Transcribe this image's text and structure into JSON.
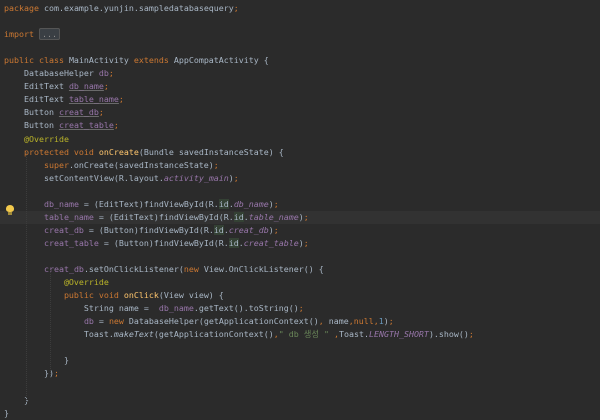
{
  "editor": {
    "lines": [
      {
        "t": [
          {
            "s": "package ",
            "c": "kw"
          },
          {
            "s": "com.example.yunjin.sampledatabasequery"
          },
          {
            "s": ";",
            "c": "kw"
          }
        ]
      },
      {
        "t": []
      },
      {
        "t": [
          {
            "s": "import ",
            "c": "kw"
          },
          {
            "s": "...",
            "c": "fold"
          }
        ]
      },
      {
        "t": []
      },
      {
        "t": [
          {
            "s": "public class ",
            "c": "kw"
          },
          {
            "s": "MainActivity "
          },
          {
            "s": "extends ",
            "c": "kw"
          },
          {
            "s": "AppCompatActivity {"
          }
        ]
      },
      {
        "t": [
          {
            "s": "    DatabaseHelper "
          },
          {
            "s": "db",
            "c": "fld"
          },
          {
            "s": ";",
            "c": "kw"
          }
        ]
      },
      {
        "t": [
          {
            "s": "    EditText "
          },
          {
            "s": "db_name",
            "c": "fld ul"
          },
          {
            "s": ";",
            "c": "kw"
          }
        ]
      },
      {
        "t": [
          {
            "s": "    EditText "
          },
          {
            "s": "table_name",
            "c": "fld ul"
          },
          {
            "s": ";",
            "c": "kw"
          }
        ]
      },
      {
        "t": [
          {
            "s": "    Button "
          },
          {
            "s": "creat_db",
            "c": "fld ul"
          },
          {
            "s": ";",
            "c": "kw"
          }
        ]
      },
      {
        "t": [
          {
            "s": "    Button "
          },
          {
            "s": "creat_table",
            "c": "fld ul"
          },
          {
            "s": ";",
            "c": "kw"
          }
        ]
      },
      {
        "t": [
          {
            "s": "    @Override",
            "c": "ann"
          }
        ]
      },
      {
        "t": [
          {
            "s": "    protected void ",
            "c": "kw"
          },
          {
            "s": "onCreate",
            "c": "fn"
          },
          {
            "s": "(Bundle savedInstanceState) {"
          }
        ]
      },
      {
        "t": [
          {
            "s": "        super",
            "c": "kw"
          },
          {
            "s": ".onCreate(savedInstanceState)"
          },
          {
            "s": ";",
            "c": "kw"
          }
        ]
      },
      {
        "t": [
          {
            "s": "        setContentView(R.layout."
          },
          {
            "s": "activity_main",
            "c": "ital"
          },
          {
            "s": ")"
          },
          {
            "s": ";",
            "c": "kw"
          }
        ]
      },
      {
        "t": []
      },
      {
        "t": [
          {
            "s": "        "
          },
          {
            "s": "db_name",
            "c": "fld"
          },
          {
            "s": " = (EditText)findViewById(R."
          },
          {
            "s": "id",
            "c": "idhl"
          },
          {
            "s": "."
          },
          {
            "s": "db_name",
            "c": "ital"
          },
          {
            "s": ")"
          },
          {
            "s": ";",
            "c": "kw"
          }
        ]
      },
      {
        "t": [
          {
            "s": "        "
          },
          {
            "s": "table_name",
            "c": "fld"
          },
          {
            "s": " = (EditText)findViewById(R."
          },
          {
            "s": "id",
            "c": "idhl"
          },
          {
            "s": "."
          },
          {
            "s": "table_name",
            "c": "ital"
          },
          {
            "s": ")"
          },
          {
            "s": ";",
            "c": "kw"
          }
        ]
      },
      {
        "t": [
          {
            "s": "        "
          },
          {
            "s": "creat_db",
            "c": "fld"
          },
          {
            "s": " = (Button)findViewById(R."
          },
          {
            "s": "id",
            "c": "idhl"
          },
          {
            "s": "."
          },
          {
            "s": "creat_db",
            "c": "ital"
          },
          {
            "s": ")"
          },
          {
            "s": ";",
            "c": "kw"
          }
        ]
      },
      {
        "t": [
          {
            "s": "        "
          },
          {
            "s": "creat_table",
            "c": "fld"
          },
          {
            "s": " = (Button)findViewById(R."
          },
          {
            "s": "id",
            "c": "idhl"
          },
          {
            "s": "."
          },
          {
            "s": "creat_table",
            "c": "ital"
          },
          {
            "s": ")"
          },
          {
            "s": ";",
            "c": "kw"
          }
        ]
      },
      {
        "t": []
      },
      {
        "t": [
          {
            "s": "        "
          },
          {
            "s": "creat_db",
            "c": "fld"
          },
          {
            "s": ".setOnClickListener("
          },
          {
            "s": "new ",
            "c": "kw"
          },
          {
            "s": "View.OnClickListener() {"
          }
        ]
      },
      {
        "t": [
          {
            "s": "            @Override",
            "c": "ann"
          }
        ]
      },
      {
        "t": [
          {
            "s": "            public void ",
            "c": "kw"
          },
          {
            "s": "onClick",
            "c": "fn"
          },
          {
            "s": "(View view) {"
          }
        ]
      },
      {
        "t": [
          {
            "s": "                String name =  "
          },
          {
            "s": "db_name",
            "c": "fld"
          },
          {
            "s": ".getText().toString()"
          },
          {
            "s": ";",
            "c": "kw"
          }
        ]
      },
      {
        "t": [
          {
            "s": "                "
          },
          {
            "s": "db",
            "c": "fld"
          },
          {
            "s": " = "
          },
          {
            "s": "new ",
            "c": "kw"
          },
          {
            "s": "DatabaseHelper(getApplicationContext()"
          },
          {
            "s": ", ",
            "c": "kw"
          },
          {
            "s": "name"
          },
          {
            "s": ",",
            "c": "kw"
          },
          {
            "s": "null",
            "c": "kw"
          },
          {
            "s": ",",
            "c": "kw"
          },
          {
            "s": "1",
            "c": "num"
          },
          {
            "s": ")"
          },
          {
            "s": ";",
            "c": "kw"
          }
        ]
      },
      {
        "t": [
          {
            "s": "                Toast."
          },
          {
            "s": "makeText",
            "c": "itw"
          },
          {
            "s": "(getApplicationContext()"
          },
          {
            "s": ",",
            "c": "kw"
          },
          {
            "s": "\" db 생성 \"",
            "c": "str"
          },
          {
            "s": " ,",
            "c": "kw"
          },
          {
            "s": "Toast."
          },
          {
            "s": "LENGTH_SHORT",
            "c": "ital"
          },
          {
            "s": ").show()"
          },
          {
            "s": ";",
            "c": "kw"
          }
        ]
      },
      {
        "t": []
      },
      {
        "t": [
          {
            "s": "            }"
          }
        ]
      },
      {
        "t": [
          {
            "s": "        })"
          },
          {
            "s": ";",
            "c": "kw"
          }
        ]
      },
      {
        "t": []
      },
      {
        "t": [
          {
            "s": "    }"
          }
        ]
      },
      {
        "t": [
          {
            "s": "}"
          }
        ]
      }
    ],
    "caret_line": 16,
    "intention_icon": "lightbulb-icon"
  }
}
